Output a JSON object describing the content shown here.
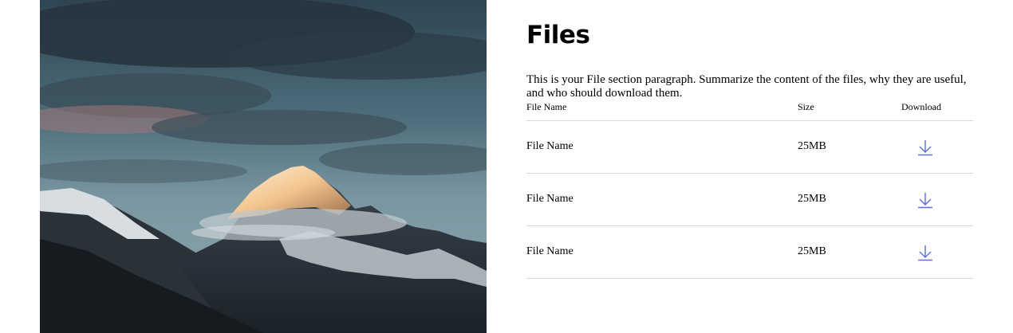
{
  "section": {
    "title": "Files",
    "paragraph": "This is your File section paragraph. Summarize the content of the files, why they are useful, and who should download them."
  },
  "table": {
    "headers": {
      "name": "File Name",
      "size": "Size",
      "download": "Download"
    },
    "rows": [
      {
        "name": "File Name",
        "size": "25MB",
        "download_icon": "download-icon"
      },
      {
        "name": "File Name",
        "size": "25MB",
        "download_icon": "download-icon"
      },
      {
        "name": "File Name",
        "size": "25MB",
        "download_icon": "download-icon"
      }
    ]
  },
  "colors": {
    "accent": "#5b6fd6",
    "divider": "#d9d9d9"
  },
  "image": {
    "subject": "mountain-peak-photo"
  }
}
